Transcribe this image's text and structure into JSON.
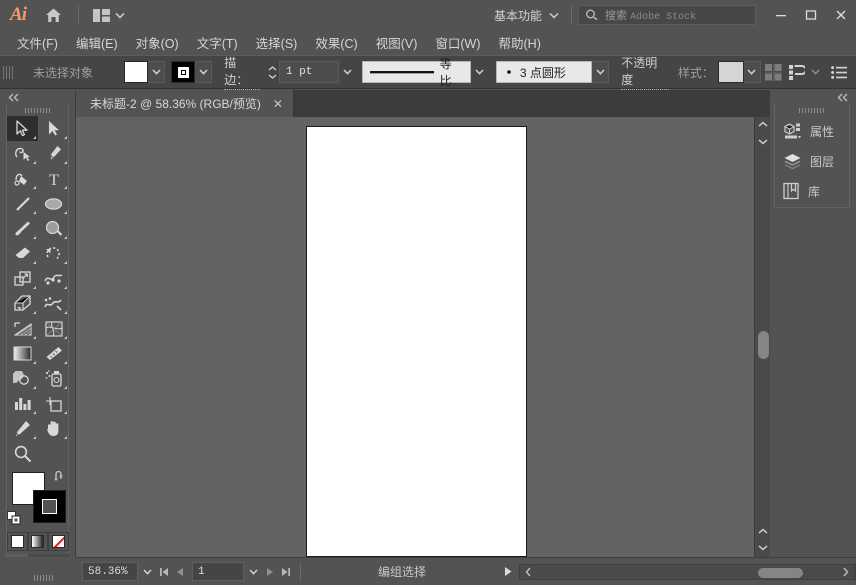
{
  "app": {
    "logo_text": "Ai",
    "home_icon": "home-icon",
    "arrange_icon": "arrange-documents-icon"
  },
  "titlebar": {
    "workspace_label": "基本功能",
    "search_placeholder_prefix": "搜索",
    "search_placeholder_stock": "Adobe Stock",
    "minimize_label": "—",
    "maximize_label": "❐",
    "close_label": "✕"
  },
  "menubar": {
    "items": [
      {
        "label": "文件(F)"
      },
      {
        "label": "编辑(E)"
      },
      {
        "label": "对象(O)"
      },
      {
        "label": "文字(T)"
      },
      {
        "label": "选择(S)"
      },
      {
        "label": "效果(C)"
      },
      {
        "label": "视图(V)"
      },
      {
        "label": "窗口(W)"
      },
      {
        "label": "帮助(H)"
      }
    ]
  },
  "controlbar": {
    "selection_status": "未选择对象",
    "fill_color": "#ffffff",
    "stroke_color": "#000000",
    "stroke_label": "描边：",
    "stroke_weight": "1 pt",
    "stroke_profile": "等比",
    "brush_definition": "3 点圆形",
    "opacity_label": "不透明度",
    "style_label": "样式：",
    "style_swatch_color": "#d5d5d5",
    "align_icon": "align-icon",
    "transform_icon": "transform-icon",
    "options_icon": "more-options-icon"
  },
  "document_tab": {
    "title": "未标题-2 @ 58.36% (RGB/预览)",
    "close_label": "✕"
  },
  "toolbar": {
    "collapse_icon": "collapse-double-arrow-icon",
    "tools": [
      {
        "name": "selection-tool",
        "label": "选择工具",
        "selected": true
      },
      {
        "name": "direct-selection-tool",
        "label": "直接选择工具",
        "selected": false
      },
      {
        "name": "magic-wand-tool",
        "label": "魔棒工具",
        "selected": false
      },
      {
        "name": "pen-tool",
        "label": "钢笔工具",
        "selected": false
      },
      {
        "name": "curvature-tool",
        "label": "曲率工具",
        "selected": false
      },
      {
        "name": "type-tool",
        "label": "文字工具",
        "selected": false
      },
      {
        "name": "line-segment-tool",
        "label": "直线段工具",
        "selected": false
      },
      {
        "name": "ellipse-tool",
        "label": "椭圆工具",
        "selected": false
      },
      {
        "name": "paintbrush-tool",
        "label": "画笔工具",
        "selected": false
      },
      {
        "name": "shaper-tool",
        "label": "Shaper 工具",
        "selected": false
      },
      {
        "name": "eraser-tool",
        "label": "橡皮擦工具",
        "selected": false
      },
      {
        "name": "rotate-tool",
        "label": "旋转工具",
        "selected": false
      },
      {
        "name": "scale-tool",
        "label": "比例缩放工具",
        "selected": false
      },
      {
        "name": "width-tool",
        "label": "宽度工具",
        "selected": false
      },
      {
        "name": "free-transform-tool",
        "label": "自由变换工具",
        "selected": false
      },
      {
        "name": "shape-builder-tool",
        "label": "形状生成器工具",
        "selected": false
      },
      {
        "name": "perspective-grid-tool",
        "label": "透视网格工具",
        "selected": false
      },
      {
        "name": "mesh-tool",
        "label": "网格工具",
        "selected": false
      },
      {
        "name": "gradient-tool",
        "label": "渐变工具",
        "selected": false
      },
      {
        "name": "eyedropper-tool",
        "label": "吸管工具",
        "selected": false
      },
      {
        "name": "blend-tool",
        "label": "混合工具",
        "selected": false
      },
      {
        "name": "symbol-sprayer-tool",
        "label": "符号喷枪工具",
        "selected": false
      },
      {
        "name": "column-graph-tool",
        "label": "柱形图工具",
        "selected": false
      },
      {
        "name": "artboard-tool",
        "label": "画板工具",
        "selected": false
      },
      {
        "name": "slice-tool",
        "label": "切片工具",
        "selected": false
      },
      {
        "name": "hand-tool",
        "label": "抓手工具",
        "selected": false
      },
      {
        "name": "zoom-tool",
        "label": "缩放工具",
        "selected": false
      }
    ],
    "color_controls": {
      "fill_color": "#ffffff",
      "stroke_color": "#000000",
      "swap_icon": "swap-fill-stroke-icon",
      "default_icon": "default-fill-stroke-icon"
    },
    "color_modes": [
      {
        "name": "color-mode-color",
        "active": true
      },
      {
        "name": "color-mode-gradient",
        "active": false
      },
      {
        "name": "color-mode-none",
        "active": false
      }
    ],
    "draw_modes": [
      {
        "name": "draw-normal-mode",
        "active": true
      },
      {
        "name": "draw-behind-mode",
        "active": false
      },
      {
        "name": "draw-inside-mode",
        "active": false
      }
    ],
    "screen_mode_icon": "change-screen-mode-icon"
  },
  "right_panel": {
    "collapse_icon": "collapse-double-arrow-icon",
    "items": [
      {
        "label": "属性",
        "icon": "properties-icon"
      },
      {
        "label": "图层",
        "icon": "layers-icon"
      },
      {
        "label": "库",
        "icon": "libraries-icon"
      }
    ]
  },
  "statusbar": {
    "zoom_level": "58.36%",
    "first_page_icon": "first-artboard-icon",
    "prev_page_icon": "previous-artboard-icon",
    "page_number": "1",
    "next_page_icon": "next-artboard-icon",
    "last_page_icon": "last-artboard-icon",
    "status_text": "编组选择",
    "play_icon": "status-menu-icon"
  },
  "canvas": {
    "artboard_color": "#ffffff",
    "background_color": "#636363",
    "scroll_up_icon": "scroll-up-icon",
    "scroll_down_icon": "scroll-down-icon"
  }
}
